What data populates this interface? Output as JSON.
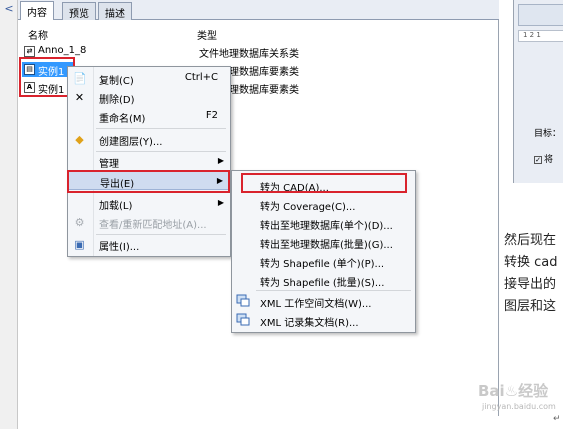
{
  "tabs": [
    "内容",
    "预览",
    "描述"
  ],
  "columns": {
    "name": "名称",
    "type": "类型"
  },
  "rows": [
    {
      "icon": "relationship-class-icon",
      "name": "Anno_1_8",
      "type": "文件地理数据库关系类"
    },
    {
      "icon": "feature-class-icon",
      "name": "实例1",
      "type": "文件地理数据库要素类"
    },
    {
      "icon": "annotation-class-icon",
      "name": "实例1",
      "type": "文件地理数据库要素类"
    }
  ],
  "context_menu": [
    {
      "label": "复制(C)",
      "shortcut": "Ctrl+C",
      "icon": "copy-icon"
    },
    {
      "label": "删除(D)",
      "shortcut": "",
      "icon": "delete-icon"
    },
    {
      "label": "重命名(M)",
      "shortcut": "F2",
      "icon": ""
    },
    {
      "label": "创建图层(Y)...",
      "shortcut": "",
      "icon": "create-layer-icon"
    },
    {
      "label": "管理",
      "shortcut": "",
      "icon": "",
      "submenu": true
    },
    {
      "label": "导出(E)",
      "shortcut": "",
      "icon": "",
      "submenu": true,
      "selected": true
    },
    {
      "label": "加载(L)",
      "shortcut": "",
      "icon": "",
      "submenu": true
    },
    {
      "label": "查看/重新匹配地址(A)...",
      "shortcut": "",
      "icon": "geocode-icon",
      "disabled": true
    },
    {
      "label": "属性(I)...",
      "shortcut": "",
      "icon": "properties-icon"
    }
  ],
  "export_submenu": [
    {
      "label": "转为 CAD(A)...",
      "icon": ""
    },
    {
      "label": "转为 Coverage(C)...",
      "icon": ""
    },
    {
      "label": "转出至地理数据库(单个)(D)...",
      "icon": ""
    },
    {
      "label": "转出至地理数据库(批量)(G)...",
      "icon": ""
    },
    {
      "label": "转为 Shapefile (单个)(P)...",
      "icon": ""
    },
    {
      "label": "转为 Shapefile (批量)(S)...",
      "icon": ""
    },
    {
      "label": "XML 工作空间文档(W)...",
      "icon": "xml-workspace-icon"
    },
    {
      "label": "XML 记录集文档(R)...",
      "icon": "xml-recordset-icon"
    }
  ],
  "right_pane": {
    "ruler": "1 2 1",
    "target_label": "目标：",
    "check_label": "将",
    "text_lines": [
      "然后现在",
      "转换 cad",
      "接导出的",
      "图层和这"
    ]
  },
  "watermark": {
    "brand": "Bai♨经验",
    "url": "jingyan.baidu.com"
  },
  "corner_mark": "↵",
  "colors": {
    "highlight": "#3399ff",
    "redbox": "#d9232d",
    "menu_bg": "#f4f6f9"
  }
}
